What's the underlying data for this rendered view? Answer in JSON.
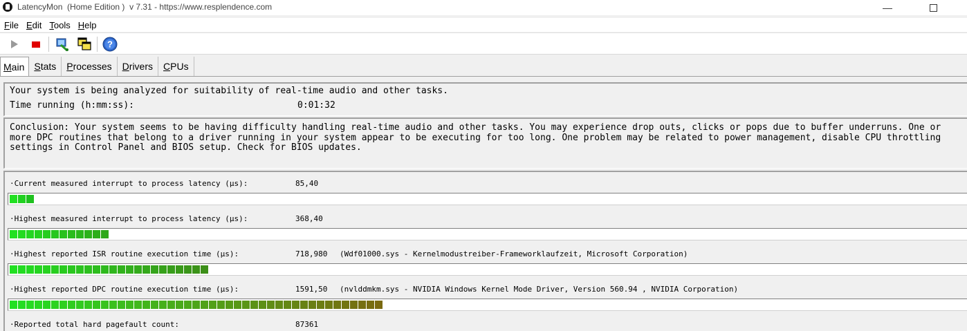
{
  "window": {
    "title": "LatencyMon  (Home Edition )  v 7.31 - https://www.resplendence.com",
    "minimize_glyph": "—"
  },
  "menu": [
    {
      "label": "File",
      "accel": "F",
      "rest": "ile"
    },
    {
      "label": "Edit",
      "accel": "E",
      "rest": "dit"
    },
    {
      "label": "Tools",
      "accel": "T",
      "rest": "ools"
    },
    {
      "label": "Help",
      "accel": "H",
      "rest": "elp"
    }
  ],
  "toolbar": {
    "buttons": [
      "play-icon",
      "stop-icon",
      "process-icon",
      "windows-icon",
      "help-icon"
    ],
    "help_glyph": "?"
  },
  "tabs": [
    {
      "label": "Main",
      "accel": "M",
      "rest": "ain",
      "active": true
    },
    {
      "label": "Stats",
      "accel": "S",
      "rest": "tats",
      "active": false
    },
    {
      "label": "Processes",
      "accel": "P",
      "rest": "rocesses",
      "active": false
    },
    {
      "label": "Drivers",
      "accel": "D",
      "rest": "rivers",
      "active": false
    },
    {
      "label": "CPUs",
      "accel": "C",
      "rest": "PUs",
      "active": false
    }
  ],
  "status": {
    "analyzing": "Your system is being analyzed for suitability of real-time audio and other tasks.",
    "time_label": "Time running (h:mm:ss):",
    "time_value": "0:01:32"
  },
  "conclusion": {
    "line1": "Conclusion: Your system seems to be having difficulty handling real-time audio and other tasks. You may experience drop outs, clicks or pops due to buffer underruns. One or",
    "line2": "more DPC routines that belong to a driver running in your system appear to be executing for too long. One problem may be related to power management, disable CPU throttling",
    "line3": "settings in Control Panel and BIOS setup. Check for BIOS updates."
  },
  "metrics": [
    {
      "label": "·Current measured interrupt to process latency (µs):",
      "value": "85,40",
      "detail": "",
      "bar_segments": 3,
      "color_end": "#1fc11f"
    },
    {
      "label": "·Highest measured interrupt to process latency (µs):",
      "value": "368,40",
      "detail": "",
      "bar_segments": 12,
      "color_end": "#2ea81a"
    },
    {
      "label": "·Highest reported ISR routine execution time (µs):",
      "value": "718,980",
      "detail": "(Wdf01000.sys - Kernelmodustreiber-Frameworklaufzeit, Microsoft Corporation)",
      "bar_segments": 24,
      "color_end": "#3c8f18"
    },
    {
      "label": "·Highest reported DPC routine execution time (µs):",
      "value": "1591,50",
      "detail": "(nvlddmkm.sys - NVIDIA Windows Kernel Mode Driver, Version 560.94 , NVIDIA Corporation)",
      "bar_segments": 45,
      "color_end": "#7a6a10"
    },
    {
      "label": "·Reported total hard pagefault count:",
      "value": "87361",
      "detail": "",
      "bar_segments": 0,
      "color_end": "#1fc11f"
    }
  ],
  "colors": {
    "bar_start": "#22e022",
    "stop": "#e00000"
  }
}
